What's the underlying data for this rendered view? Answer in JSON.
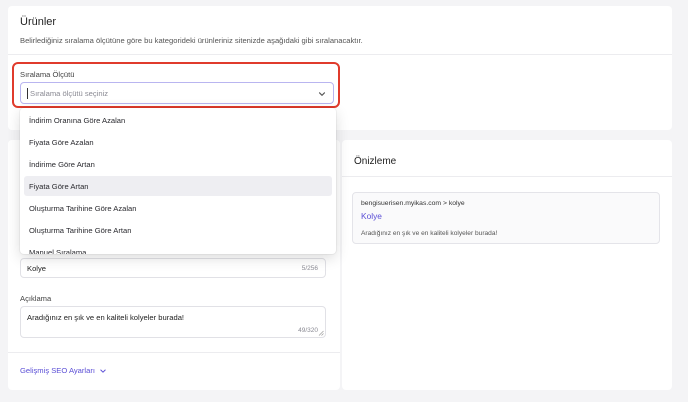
{
  "products_card": {
    "title": "Ürünler",
    "description": "Belirlediğiniz sıralama ölçütüne göre bu kategorideki ürünleriniz sitenizde aşağıdaki gibi sıralanacaktır.",
    "sort_label": "Sıralama Ölçütü",
    "sort_placeholder": "Sıralama ölçütü seçiniz"
  },
  "dropdown": {
    "options": [
      "İndirim Oranına Göre Azalan",
      "Fiyata Göre Azalan",
      "İndirime Göre Artan",
      "Fiyata Göre Artan",
      "Oluşturma Tarihine Göre Azalan",
      "Oluşturma Tarihine Göre Artan",
      "Manuel Sıralama"
    ],
    "highlighted_index": 3
  },
  "form": {
    "title_value": "Kolye",
    "title_counter": "5/256",
    "description_label": "Açıklama",
    "description_value": "Aradığınız en şık ve en kaliteli kolyeler burada!",
    "description_counter": "49/320",
    "seo_link": "Gelişmiş SEO Ayarları"
  },
  "preview": {
    "title": "Önizleme",
    "url": "bengisuerisen.myikas.com > kolye",
    "page_title": "Kolye",
    "page_description": "Aradığınız en şık ve en kaliteli kolyeler burada!"
  },
  "colors": {
    "accent": "#5b4fd6",
    "highlight_ring": "#e03b2c",
    "background": "#f4f4f6"
  }
}
